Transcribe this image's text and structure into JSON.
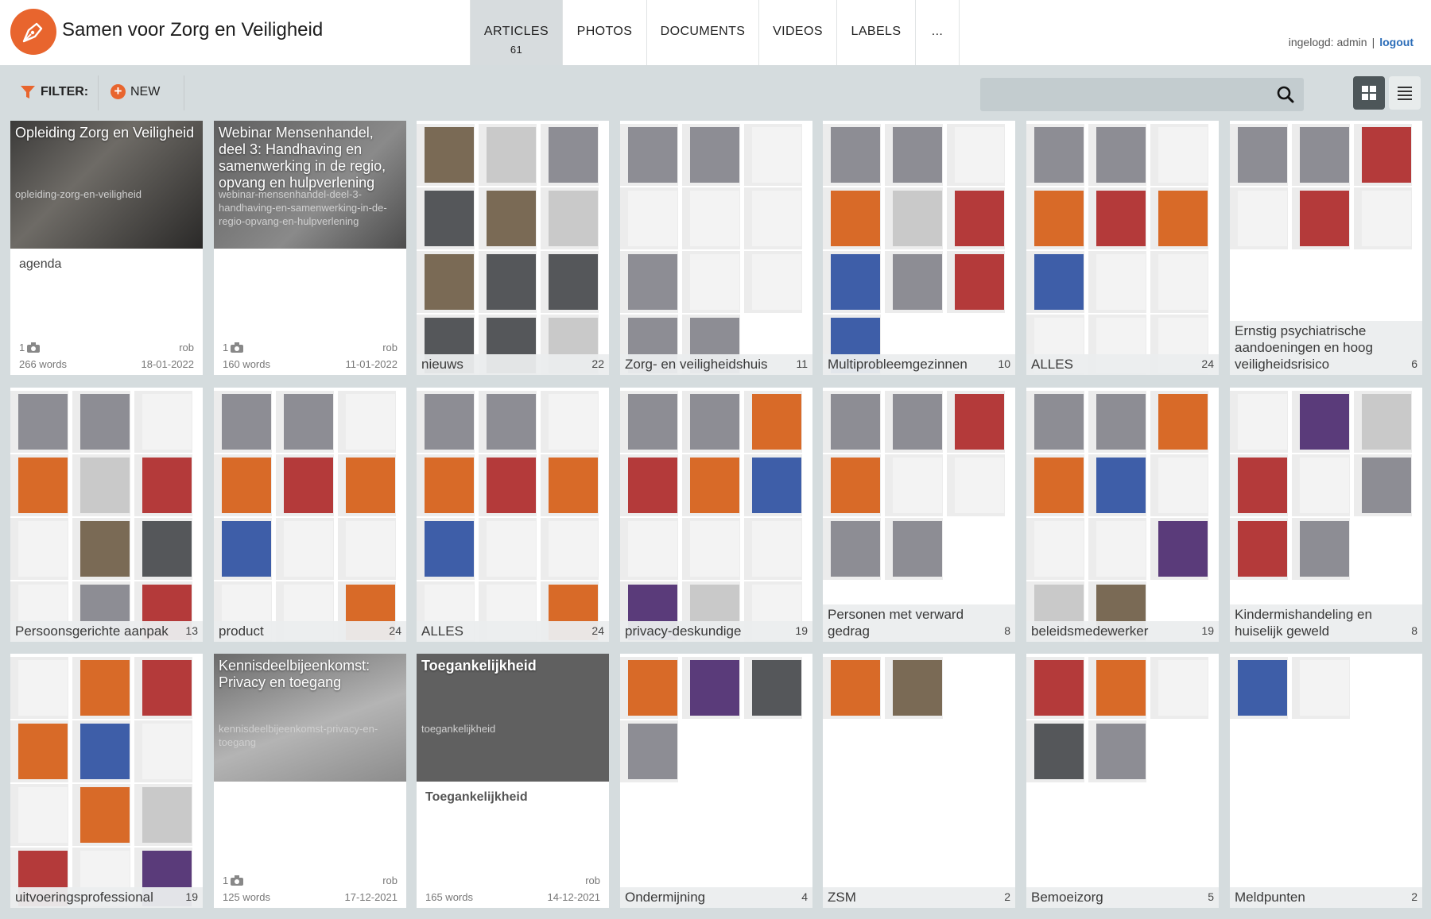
{
  "app": {
    "title": "Samen voor Zorg en Veiligheid"
  },
  "tabs": [
    {
      "label": "ARTICLES",
      "count": "61"
    },
    {
      "label": "PHOTOS"
    },
    {
      "label": "DOCUMENTS"
    },
    {
      "label": "VIDEOS"
    },
    {
      "label": "LABELS"
    },
    {
      "label": "..."
    }
  ],
  "user": {
    "logged_in": "ingelogd: admin",
    "separator": "|",
    "logout": "logout"
  },
  "toolbar": {
    "filter": "FILTER:",
    "new": "NEW",
    "search_placeholder": ""
  },
  "colors": {
    "accent": "#e8652e",
    "link": "#2a6cb8"
  },
  "articles": [
    {
      "title": "Opleiding Zorg en Veiligheid",
      "slug": "opleiding-zorg-en-veiligheid",
      "label": "agenda",
      "photos": "1",
      "user": "rob",
      "words": "266 words",
      "date": "18-01-2022"
    },
    {
      "title": "Webinar Mensenhandel, deel 3: Handhaving en samenwerking in de regio, opvang en hulpverlening",
      "slug": "webinar-mensenhandel-deel-3-handhaving-en-samenwerking-in-de-regio-opvang-en-hulpverlening",
      "label": "",
      "photos": "1",
      "user": "rob",
      "words": "160 words",
      "date": "11-01-2022"
    },
    {
      "title": "Kennisdeelbijeenkomst: Privacy en toegang",
      "slug": "kennisdeelbijeenkomst-privacy-en-toegang",
      "label": "",
      "photos": "1",
      "user": "rob",
      "words": "125 words",
      "date": "17-12-2021"
    },
    {
      "title": "Toegankelijkheid",
      "slug": "toegankelijkheid",
      "label": "Toegankelijkheid",
      "photos": "",
      "user": "rob",
      "words": "165 words",
      "date": "14-12-2021"
    }
  ],
  "labels": [
    {
      "name": "nieuws",
      "count": "22"
    },
    {
      "name": "Zorg- en veiligheidshuis",
      "count": "11"
    },
    {
      "name": "Multiprobleemgezinnen",
      "count": "10"
    },
    {
      "name": "ALLES",
      "count": "24"
    },
    {
      "name": "Ernstig psychiatrische aandoeningen en hoog veiligheidsrisico",
      "count": "6"
    },
    {
      "name": "Persoonsgerichte aanpak",
      "count": "13"
    },
    {
      "name": "product",
      "count": "24"
    },
    {
      "name": "ALLES",
      "count": "24"
    },
    {
      "name": "privacy-deskundige",
      "count": "19"
    },
    {
      "name": "Personen met verward gedrag",
      "count": "8"
    },
    {
      "name": "beleidsmedewerker",
      "count": "19"
    },
    {
      "name": "Kindermishandeling en huiselijk geweld",
      "count": "8"
    },
    {
      "name": "uitvoeringsprofessional",
      "count": "19"
    },
    {
      "name": "Ondermijning",
      "count": "4"
    },
    {
      "name": "ZSM",
      "count": "2"
    },
    {
      "name": "Bemoeizorg",
      "count": "5"
    },
    {
      "name": "Meldpunten",
      "count": "2"
    }
  ]
}
